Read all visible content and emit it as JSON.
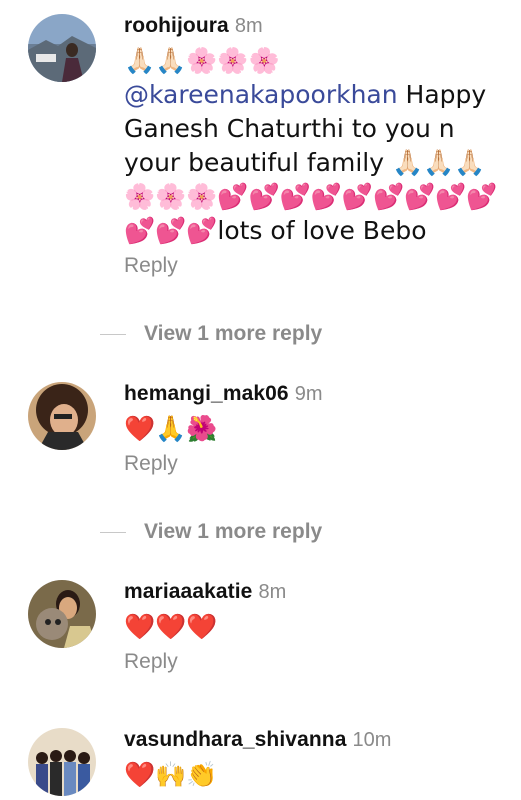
{
  "comments": [
    {
      "username": "roohijoura",
      "time": "8m",
      "line1": "🙏🏻🙏🏻🌸🌸🌸",
      "mention": "@kareenakapoorkhan",
      "text": " Happy Ganesh Chaturthi to you n your beautiful family 🙏🏻🙏🏻🙏🏻 🌸🌸🌸💕💕💕💕💕💕💕💕💕💕💕💕lots of love Bebo",
      "reply": "Reply"
    },
    {
      "username": "hemangi_mak06",
      "time": "9m",
      "text": "❤️🙏🌺",
      "reply": "Reply"
    },
    {
      "username": "mariaaakatie",
      "time": "8m",
      "text": "❤️❤️❤️",
      "reply": "Reply"
    },
    {
      "username": "vasundhara_shivanna",
      "time": "10m",
      "text": "❤️🙌👏"
    }
  ],
  "view_more": [
    {
      "label": "View 1 more reply"
    },
    {
      "label": "View 1 more reply"
    }
  ]
}
